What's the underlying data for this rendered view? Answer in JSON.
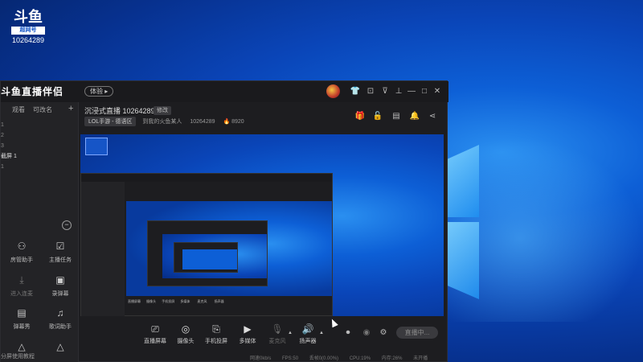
{
  "desktop": {
    "badge": {
      "logo_text": "斗鱼",
      "logo_tag": "超网号",
      "room_id": "10264289"
    }
  },
  "app": {
    "brand": "斗鱼直播伴侣",
    "version_pill": "体验 ▸",
    "left_tabs": [
      "观看",
      "可改名",
      "+"
    ],
    "sidebar_list": [
      "1",
      "2",
      "3",
      "截屏 1",
      "1"
    ],
    "tools": [
      {
        "label": "房管助手",
        "icon": "house-manager-icon"
      },
      {
        "label": "主播任务",
        "icon": "task-icon"
      },
      {
        "label": "进入连麦",
        "icon": "download-icon"
      },
      {
        "label": "录弹幕",
        "icon": "record-icon"
      },
      {
        "label": "弹幕秀",
        "icon": "barrage-icon"
      },
      {
        "label": "歌词助手",
        "icon": "lyrics-icon"
      }
    ],
    "sidebar_bottom": "分屏使用教程",
    "room_title": "沉浸式直播 10264289",
    "edit_label": "修改",
    "category": "LOL手游 - 德语区",
    "meta": [
      "到我的火鱼某人",
      "10264289",
      "🔥 8920"
    ],
    "bottom_tools": [
      {
        "label": "直播屏幕",
        "icon": "screen-icon"
      },
      {
        "label": "摄像头",
        "icon": "camera-icon"
      },
      {
        "label": "手机投屏",
        "icon": "phone-cast-icon"
      },
      {
        "label": "多媒体",
        "icon": "media-icon"
      },
      {
        "label": "麦克风",
        "icon": "mic-icon"
      },
      {
        "label": "扬声器",
        "icon": "speaker-icon"
      }
    ],
    "live_button": "直播中...",
    "status": [
      "网速0kb/s",
      "FPS:50",
      "丢帧0(0.00%)",
      "CPU:19%",
      "内存:26%",
      "未开播"
    ]
  }
}
